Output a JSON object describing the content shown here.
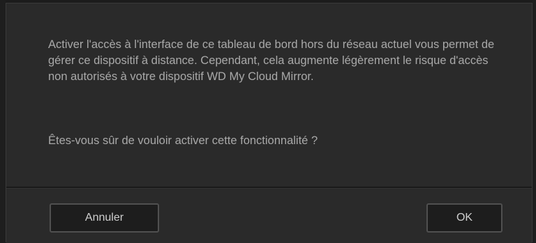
{
  "dialog": {
    "message": "Activer l'accès à l'interface de ce tableau de bord hors du réseau actuel vous permet de gérer ce dispositif à distance. Cependant, cela augmente légèrement le risque d'accès non autorisés à votre dispositif WD My Cloud Mirror.",
    "question": "Êtes-vous sûr de vouloir activer cette fonctionnalité ?"
  },
  "buttons": {
    "cancel_label": "Annuler",
    "ok_label": "OK"
  },
  "colors": {
    "background": "#2a2a2a",
    "text": "#a9a9a9",
    "button_border": "#505050",
    "button_bg": "#1d1d1d"
  }
}
